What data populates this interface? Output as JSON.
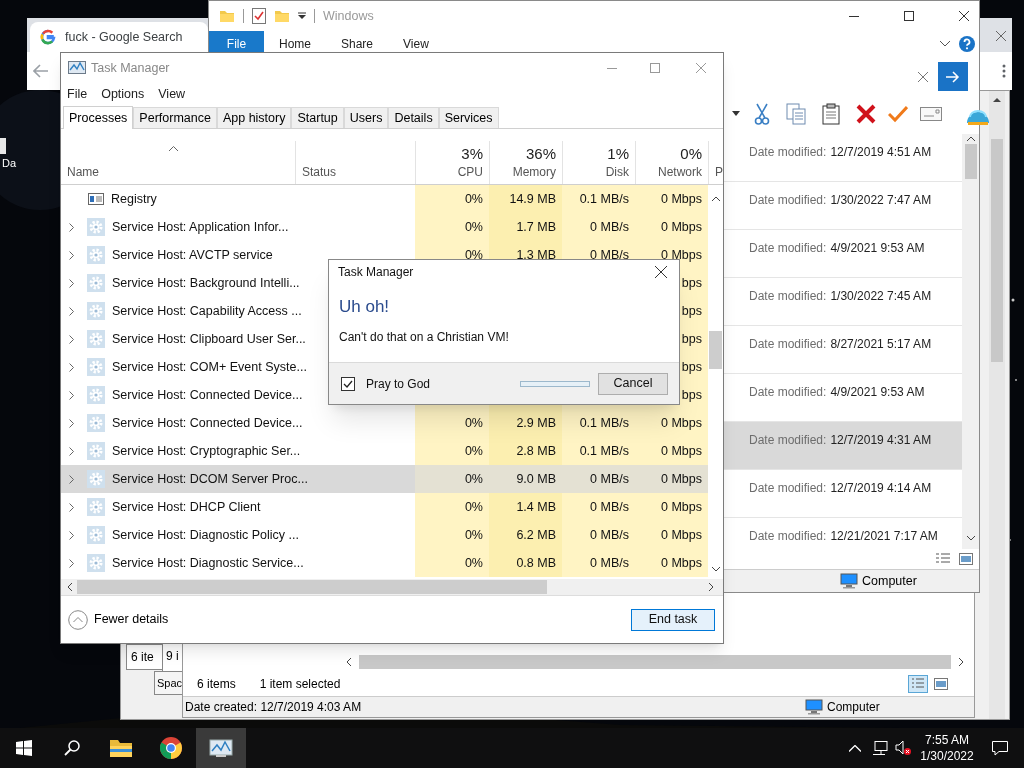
{
  "desktop": {
    "icon_label": "Da"
  },
  "browser": {
    "tab_title": "fuck - Google Search"
  },
  "back_windows": [
    {
      "text": "6 ite"
    },
    {
      "text": "9 i"
    },
    {
      "text": "Spac"
    }
  ],
  "lower_explorer": {
    "item_count": "6 items",
    "selection": "1 item selected",
    "details": "Date created: 12/7/2019 4:03 AM",
    "location": "Computer"
  },
  "explorer": {
    "title": "Windows",
    "ribbon_tabs": [
      {
        "label": "File",
        "selected": true
      },
      {
        "label": "Home",
        "selected": false
      },
      {
        "label": "Share",
        "selected": false
      },
      {
        "label": "View",
        "selected": false
      }
    ],
    "items": [
      {
        "label": "Date modified:",
        "value": "12/7/2019 4:51 AM",
        "selected": false
      },
      {
        "label": "Date modified:",
        "value": "1/30/2022 7:47 AM",
        "selected": false
      },
      {
        "label": "Date modified:",
        "value": "4/9/2021 9:53 AM",
        "selected": false
      },
      {
        "label": "Date modified:",
        "value": "1/30/2022 7:45 AM",
        "selected": false
      },
      {
        "label": "Date modified:",
        "value": "8/27/2021 5:17 AM",
        "selected": false
      },
      {
        "label": "Date modified:",
        "value": "4/9/2021 9:53 AM",
        "selected": false
      },
      {
        "label": "Date modified:",
        "value": "12/7/2019 4:31 AM",
        "selected": true
      },
      {
        "label": "Date modified:",
        "value": "12/7/2019 4:14 AM",
        "selected": false
      },
      {
        "label": "Date modified:",
        "value": "12/21/2021 7:17 AM",
        "selected": false
      }
    ],
    "status_bar": {
      "location": "Computer"
    }
  },
  "task_manager": {
    "title": "Task Manager",
    "menu": [
      "File",
      "Options",
      "View"
    ],
    "tabs": [
      {
        "label": "Processes",
        "selected": true
      },
      {
        "label": "Performance",
        "selected": false
      },
      {
        "label": "App history",
        "selected": false
      },
      {
        "label": "Startup",
        "selected": false
      },
      {
        "label": "Users",
        "selected": false
      },
      {
        "label": "Details",
        "selected": false
      },
      {
        "label": "Services",
        "selected": false
      }
    ],
    "columns": [
      {
        "label": "Name"
      },
      {
        "label": "Status"
      },
      {
        "percent": "3%",
        "label": "CPU"
      },
      {
        "percent": "36%",
        "label": "Memory"
      },
      {
        "percent": "1%",
        "label": "Disk"
      },
      {
        "percent": "0%",
        "label": "Network"
      },
      {
        "label": "P"
      }
    ],
    "rows": [
      {
        "name": "Registry",
        "kind": "registry",
        "expandable": false,
        "selected": false,
        "cpu": "0%",
        "memory": "14.9 MB",
        "disk": "0.1 MB/s",
        "network": "0 Mbps"
      },
      {
        "name": "Service Host: Application Infor...",
        "kind": "service",
        "expandable": true,
        "selected": false,
        "cpu": "0%",
        "memory": "1.7 MB",
        "disk": "0 MB/s",
        "network": "0 Mbps"
      },
      {
        "name": "Service Host: AVCTP service",
        "kind": "service",
        "expandable": true,
        "selected": false,
        "cpu": "0%",
        "memory": "1.3 MB",
        "disk": "0 MB/s",
        "network": "0 Mbps"
      },
      {
        "name": "Service Host: Background Intelli...",
        "kind": "service",
        "expandable": true,
        "selected": false,
        "network": "bps"
      },
      {
        "name": "Service Host: Capability Access ...",
        "kind": "service",
        "expandable": true,
        "selected": false,
        "network": "bps"
      },
      {
        "name": "Service Host: Clipboard User Ser...",
        "kind": "service",
        "expandable": true,
        "selected": false,
        "network": "bps"
      },
      {
        "name": "Service Host: COM+ Event Syste...",
        "kind": "service",
        "expandable": true,
        "selected": false,
        "network": "bps"
      },
      {
        "name": "Service Host: Connected Device...",
        "kind": "service",
        "expandable": true,
        "selected": false,
        "network": "bps"
      },
      {
        "name": "Service Host: Connected Device...",
        "kind": "service",
        "expandable": true,
        "selected": false,
        "cpu": "0%",
        "memory": "2.9 MB",
        "disk": "0.1 MB/s",
        "network": "0 Mbps"
      },
      {
        "name": "Service Host: Cryptographic Ser...",
        "kind": "service",
        "expandable": true,
        "selected": false,
        "cpu": "0%",
        "memory": "2.8 MB",
        "disk": "0.1 MB/s",
        "network": "0 Mbps"
      },
      {
        "name": "Service Host: DCOM Server Proc...",
        "kind": "service",
        "expandable": true,
        "selected": true,
        "cpu": "0%",
        "memory": "9.0 MB",
        "disk": "0 MB/s",
        "network": "0 Mbps"
      },
      {
        "name": "Service Host: DHCP Client",
        "kind": "service",
        "expandable": true,
        "selected": false,
        "cpu": "0%",
        "memory": "1.4 MB",
        "disk": "0 MB/s",
        "network": "0 Mbps"
      },
      {
        "name": "Service Host: Diagnostic Policy ...",
        "kind": "service",
        "expandable": true,
        "selected": false,
        "cpu": "0%",
        "memory": "6.2 MB",
        "disk": "0 MB/s",
        "network": "0 Mbps"
      },
      {
        "name": "Service Host: Diagnostic Service...",
        "kind": "service",
        "expandable": true,
        "selected": false,
        "cpu": "0%",
        "memory": "0.8 MB",
        "disk": "0 MB/s",
        "network": "0 Mbps"
      }
    ],
    "fewer_details": "Fewer details",
    "end_task": "End task"
  },
  "dialog": {
    "title": "Task Manager",
    "heading": "Uh oh!",
    "message": "Can't do that on a Christian VM!",
    "checkbox": {
      "label": "Pray to God",
      "checked": true
    },
    "progress": {
      "level": 0
    },
    "button": "Cancel"
  },
  "taskbar": {
    "apps": [
      {
        "kind": "folder",
        "selected": false
      },
      {
        "kind": "chrome",
        "selected": false
      },
      {
        "kind": "taskmgr",
        "selected": true
      }
    ],
    "time": "7:55 AM",
    "date": "1/30/2022"
  }
}
